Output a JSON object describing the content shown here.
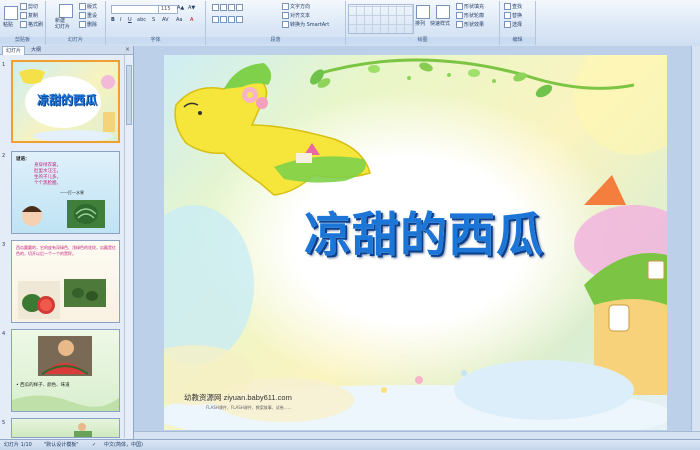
{
  "ribbon": {
    "clipboard": {
      "paste": "粘贴",
      "cut": "剪切",
      "copy": "复制",
      "format_painter": "格式刷",
      "label": "剪贴板"
    },
    "slides": {
      "new_slide": "新建\n幻灯片",
      "layout": "版式",
      "reset": "重设",
      "delete": "删除",
      "label": "幻灯片"
    },
    "font": {
      "size": "115",
      "label": "字体"
    },
    "paragraph": {
      "text_direction": "文字方向",
      "align_text": "对齐文本",
      "smartart": "转换为 SmartArt",
      "label": "段落"
    },
    "drawing": {
      "arrange": "排列",
      "quick_styles": "快速样式",
      "shape_fill": "形状填充",
      "shape_outline": "形状轮廓",
      "shape_effects": "形状效果",
      "label": "绘图"
    },
    "editing": {
      "find": "查找",
      "replace": "替换",
      "select": "选择",
      "label": "编辑"
    }
  },
  "left_pane": {
    "tabs": [
      "幻灯片",
      "大纲"
    ],
    "close": "×",
    "slides": [
      {
        "num": "1",
        "title": "凉甜的西瓜"
      },
      {
        "num": "2",
        "heading": "谜语：",
        "lines": [
          "身穿绿衣裳，",
          "肚里水汪汪，",
          "生的子儿多，",
          "个个黑脸膛。"
        ],
        "answer": "——打一水果"
      },
      {
        "num": "3",
        "text": "西瓜圆圆的，它的皮有深绿色、浅绿色的花纹，瓜瓤是红色的，切开以后一个一个的黑籽。"
      },
      {
        "num": "4",
        "caption": "• 西瓜的样子、颜色、味道"
      },
      {
        "num": "5"
      }
    ]
  },
  "slide": {
    "title": "凉甜的西瓜",
    "footer": "幼教资源网 ziyuan.baby611.com",
    "footer_sub": "FLASH课件、FLASH课件、教案故事、试卷……"
  },
  "status": {
    "slide_pos": "幻灯片 1/10",
    "theme": "\"默认设计模板\"",
    "language": "中文(简体，中国)"
  },
  "colors": {
    "title": "#1b76d8",
    "selection": "#f0a030",
    "ribbon_bg": "#dbe7f6"
  }
}
